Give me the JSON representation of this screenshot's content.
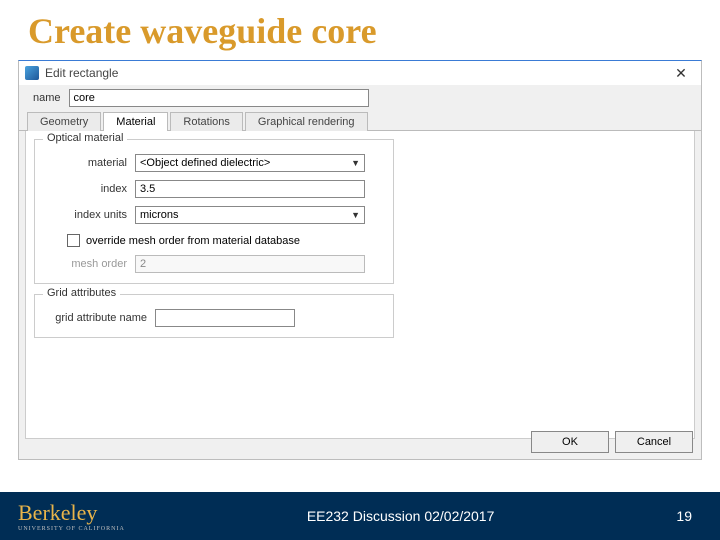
{
  "slide": {
    "title": "Create waveguide core"
  },
  "dialog": {
    "title": "Edit rectangle",
    "name_label": "name",
    "name_value": "core",
    "tabs": {
      "geometry": "Geometry",
      "material": "Material",
      "rotations": "Rotations",
      "rendering": "Graphical rendering"
    },
    "optical_group": {
      "title": "Optical material",
      "material_label": "material",
      "material_value": "<Object defined dielectric>",
      "index_label": "index",
      "index_value": "3.5",
      "units_label": "index units",
      "units_value": "microns",
      "override_label": "override mesh order from material database",
      "mesh_label": "mesh order",
      "mesh_value": "2"
    },
    "grid_group": {
      "title": "Grid attributes",
      "attr_label": "grid attribute name",
      "attr_value": ""
    },
    "buttons": {
      "ok": "OK",
      "cancel": "Cancel"
    }
  },
  "footer": {
    "logo": "Berkeley",
    "logo_sub": "UNIVERSITY OF CALIFORNIA",
    "center": "EE232 Discussion 02/02/2017",
    "page": "19"
  }
}
